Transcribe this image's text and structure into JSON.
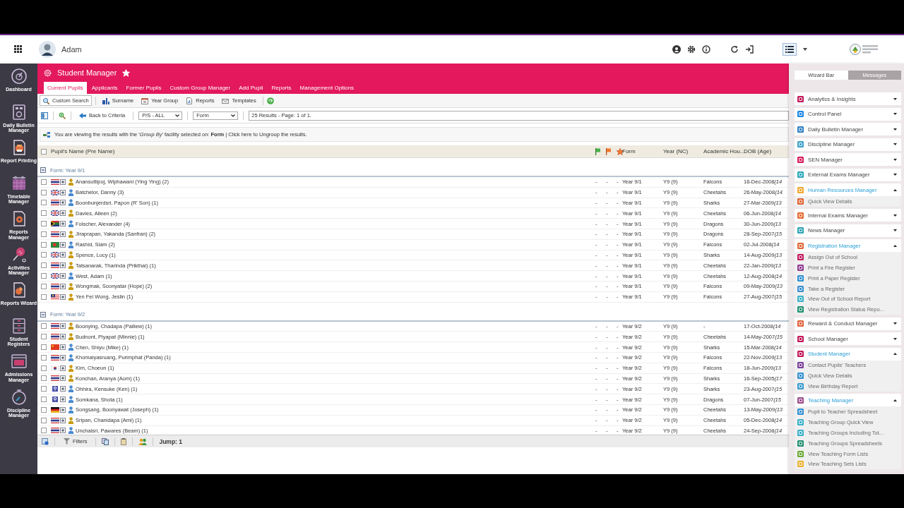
{
  "user": {
    "name": "Adam"
  },
  "sidebar": {
    "items": [
      {
        "label": "Dashboard"
      },
      {
        "label": "Daily Bulletin Manager"
      },
      {
        "label": "Report Printing"
      },
      {
        "label": "Timetable Manager"
      },
      {
        "label": "Reports Manager"
      },
      {
        "label": "Activities Manager"
      },
      {
        "label": "Reports Wizard"
      },
      {
        "label": "Student Registers"
      },
      {
        "label": "Admissions Manager"
      },
      {
        "label": "Discipline Manager"
      }
    ]
  },
  "module": {
    "title": "Student Manager",
    "favorite": true,
    "tabs": [
      {
        "label": "Current Pupils",
        "selected": true
      },
      {
        "label": "Applicants",
        "selected": false
      },
      {
        "label": "Former Pupils",
        "selected": false
      },
      {
        "label": "Custom Group Manager",
        "selected": false
      },
      {
        "label": "Add Pupil",
        "selected": false
      },
      {
        "label": "Reports",
        "selected": false
      },
      {
        "label": "Management Options",
        "selected": false
      }
    ]
  },
  "toolbar": {
    "buttons": [
      {
        "label": "Custom Search",
        "selected": true
      },
      {
        "label": "Surname",
        "selected": false
      },
      {
        "label": "Year Group",
        "selected": false
      },
      {
        "label": "Reports",
        "selected": false
      },
      {
        "label": "Templates",
        "selected": false
      }
    ]
  },
  "filter_bar": {
    "back": "Back to Criteria",
    "selects": [
      {
        "value": "P/S - ALL"
      },
      {
        "value": "Form"
      }
    ],
    "results": "25 Results - Page: 1 of 1."
  },
  "notice": "You are viewing the results with the '*Group By*' facility selected on: **Form** | Click here to Ungroup the results.",
  "table": {
    "select_all": {
      "checked": false
    },
    "columns": [
      "Pupil's Name (Pre Name)",
      "Form",
      "Year (NC)",
      "Academic Hou...",
      "DOB (Age)"
    ],
    "groups": [
      {
        "label": "Form: Year 9/1",
        "expanded": true,
        "rows": [
          {
            "name": "Anansuttipoj, Wiphawani (Ying Ying) (2)",
            "checked": false,
            "flag": {
              "kind": "th"
            },
            "person": {
              "kind": "female"
            },
            "marks": [
              "-",
              "-",
              "-"
            ],
            "form": "Year 9/1",
            "year": "Y9 (9)",
            "house": "Falcons",
            "dob": "16-Dec-2008",
            "age": "(14"
          },
          {
            "name": "Batchelor, Danny (3)",
            "checked": false,
            "flag": {
              "kind": "uk"
            },
            "person": {
              "kind": "male"
            },
            "marks": [
              "-",
              "-",
              "-"
            ],
            "form": "Year 9/1",
            "year": "Y9 (9)",
            "house": "Cheetahs",
            "dob": "26-May-2008",
            "age": "(14"
          },
          {
            "name": "Boonbunjerdsri, Papon (R' Son) (1)",
            "checked": false,
            "flag": {
              "kind": "th"
            },
            "person": {
              "kind": "male"
            },
            "marks": [
              "-",
              "-",
              "-"
            ],
            "form": "Year 9/1",
            "year": "Y9 (9)",
            "house": "Sharks",
            "dob": "27-Mar-2009",
            "age": "(13"
          },
          {
            "name": "Davies, Aileen (2)",
            "checked": false,
            "flag": {
              "kind": "uk"
            },
            "person": {
              "kind": "female"
            },
            "marks": [
              "-",
              "-",
              "-"
            ],
            "form": "Year 9/1",
            "year": "Y9 (9)",
            "house": "Cheetahs",
            "dob": "06-Jun-2008",
            "age": "(14"
          },
          {
            "name": "Folscher, Alexander (4)",
            "checked": false,
            "flag": {
              "kind": "za"
            },
            "person": {
              "kind": "male"
            },
            "marks": [
              "-",
              "-",
              "-"
            ],
            "form": "Year 9/1",
            "year": "Y9 (9)",
            "house": "Dragons",
            "dob": "30-Jun-2009",
            "age": "(13"
          },
          {
            "name": "Jiraprapan, Yakanda (Sanfran) (2)",
            "checked": false,
            "flag": {
              "kind": "th"
            },
            "person": {
              "kind": "female"
            },
            "marks": [
              "-",
              "-",
              "-"
            ],
            "form": "Year 9/1",
            "year": "Y9 (9)",
            "house": "Dragons",
            "dob": "28-Sep-2007",
            "age": "(15"
          },
          {
            "name": "Rashid, Siam (2)",
            "checked": false,
            "flag": {
              "kind": "bd"
            },
            "person": {
              "kind": "male"
            },
            "marks": [
              "-",
              "-",
              "-"
            ],
            "form": "Year 9/1",
            "year": "Y9 (9)",
            "house": "Falcons",
            "dob": "02-Jul-2008",
            "age": "(14"
          },
          {
            "name": "Spence, Lucy (1)",
            "checked": false,
            "flag": {
              "kind": "uk"
            },
            "person": {
              "kind": "female"
            },
            "marks": [
              "-",
              "-",
              "-"
            ],
            "form": "Year 9/1",
            "year": "Y9 (9)",
            "house": "Sharks",
            "dob": "14-Aug-2009",
            "age": "(13"
          },
          {
            "name": "Tatsanarak, Tharinda (Prikthai) (1)",
            "checked": false,
            "flag": {
              "kind": "th"
            },
            "person": {
              "kind": "female"
            },
            "marks": [
              "-",
              "-",
              "-"
            ],
            "form": "Year 9/1",
            "year": "Y9 (9)",
            "house": "Cheetahs",
            "dob": "22-Jan-2009",
            "age": "(13"
          },
          {
            "name": "West, Adam (1)",
            "checked": false,
            "flag": {
              "kind": "uk"
            },
            "person": {
              "kind": "male"
            },
            "marks": [
              "-",
              "-",
              "-"
            ],
            "form": "Year 9/1",
            "year": "Y9 (9)",
            "house": "Cheetahs",
            "dob": "12-Aug-2008",
            "age": "(14"
          },
          {
            "name": "Wongmak, Soonyatar (Hope) (2)",
            "checked": false,
            "flag": {
              "kind": "th"
            },
            "person": {
              "kind": "female"
            },
            "marks": [
              "-",
              "-",
              "-"
            ],
            "form": "Year 9/1",
            "year": "Y9 (9)",
            "house": "Falcons",
            "dob": "09-May-2009",
            "age": "(13"
          },
          {
            "name": "Yen Fei Wong, Jeslin (1)",
            "checked": false,
            "flag": {
              "kind": "my"
            },
            "person": {
              "kind": "female"
            },
            "marks": [
              "-",
              "-",
              "-"
            ],
            "form": "Year 9/1",
            "year": "Y9 (9)",
            "house": "Falcons",
            "dob": "27-Aug-2007",
            "age": "(15"
          }
        ]
      },
      {
        "label": "Form: Year 9/2",
        "expanded": true,
        "rows": [
          {
            "name": "Boonying, Chadapa (Pailiew) (1)",
            "checked": false,
            "flag": {
              "kind": "th"
            },
            "person": {
              "kind": "female"
            },
            "marks": [
              "-",
              "-",
              "-"
            ],
            "form": "Year 9/2",
            "year": "Y9 (9)",
            "house": "-",
            "dob": "17-Oct-2008",
            "age": "(14"
          },
          {
            "name": "Budnont, Piyapat (Minnie) (1)",
            "checked": false,
            "flag": {
              "kind": "th"
            },
            "person": {
              "kind": "female"
            },
            "marks": [
              "-",
              "-",
              "-"
            ],
            "form": "Year 9/2",
            "year": "Y9 (9)",
            "house": "Cheetahs",
            "dob": "14-May-2007",
            "age": "(15"
          },
          {
            "name": "Chen, Shiyu (Mike) (1)",
            "checked": false,
            "flag": {
              "kind": "cn"
            },
            "person": {
              "kind": "male"
            },
            "marks": [
              "-",
              "-",
              "-"
            ],
            "form": "Year 9/2",
            "year": "Y9 (9)",
            "house": "Sharks",
            "dob": "15-Mar-2008",
            "age": "(14"
          },
          {
            "name": "Khomaiyasruang, Purimphat (Panda) (1)",
            "checked": false,
            "flag": {
              "kind": "th"
            },
            "person": {
              "kind": "male"
            },
            "marks": [
              "-",
              "-",
              "-"
            ],
            "form": "Year 9/2",
            "year": "Y9 (9)",
            "house": "Falcons",
            "dob": "22-Nov-2009",
            "age": "(13"
          },
          {
            "name": "Kim, Choeun (1)",
            "checked": false,
            "flag": {
              "kind": "kr"
            },
            "person": {
              "kind": "female"
            },
            "marks": [
              "-",
              "-",
              "-"
            ],
            "form": "Year 9/2",
            "year": "Y9 (9)",
            "house": "Falcons",
            "dob": "18-Jun-2009",
            "age": "(13"
          },
          {
            "name": "Konchan, Aranya (Aom) (1)",
            "checked": false,
            "flag": {
              "kind": "th"
            },
            "person": {
              "kind": "female"
            },
            "marks": [
              "-",
              "-",
              "-"
            ],
            "form": "Year 9/2",
            "year": "Y9 (9)",
            "house": "Sharks",
            "dob": "16-Sep-2005",
            "age": "(17"
          },
          {
            "name": "Ohhira, Kensuke (Ken) (1)",
            "checked": false,
            "flag": {
              "kind": "unknown"
            },
            "person": {
              "kind": "male"
            },
            "marks": [
              "-",
              "-",
              "-"
            ],
            "form": "Year 9/2",
            "year": "Y9 (9)",
            "house": "Sharks",
            "dob": "23-Aug-2007",
            "age": "(15"
          },
          {
            "name": "Somkana, Shota (1)",
            "checked": false,
            "flag": {
              "kind": "unknown"
            },
            "person": {
              "kind": "male"
            },
            "marks": [
              "-",
              "-",
              "-"
            ],
            "form": "Year 9/2",
            "year": "Y9 (9)",
            "house": "Dragons",
            "dob": "07-Jun-2007",
            "age": "(15"
          },
          {
            "name": "Songsang, Boonyawat (Joseph) (1)",
            "checked": false,
            "flag": {
              "kind": "de"
            },
            "person": {
              "kind": "male"
            },
            "marks": [
              "-",
              "-",
              "-"
            ],
            "form": "Year 9/2",
            "year": "Y9 (9)",
            "house": "Cheetahs",
            "dob": "13-May-2009",
            "age": "(13"
          },
          {
            "name": "Sripan, Chanidapa (Ami) (1)",
            "checked": false,
            "flag": {
              "kind": "th"
            },
            "person": {
              "kind": "female"
            },
            "marks": [
              "-",
              "-",
              "-"
            ],
            "form": "Year 9/2",
            "year": "Y9 (9)",
            "house": "Cheetahs",
            "dob": "05-Dec-2008",
            "age": "(14"
          },
          {
            "name": "Unchaisri, Pawares (Beam) (1)",
            "checked": false,
            "flag": {
              "kind": "th"
            },
            "person": {
              "kind": "male"
            },
            "marks": [
              "-",
              "-",
              "-"
            ],
            "form": "Year 9/2",
            "year": "Y9 (9)",
            "house": "Cheetahs",
            "dob": "24-Sep-2008",
            "age": "(14"
          }
        ]
      }
    ]
  },
  "status_bar": {
    "filters": "Filters",
    "jump": "Jump: 1"
  },
  "wizard": {
    "tabs": [
      {
        "label": "Wizard Bar",
        "selected": true
      },
      {
        "label": "Messages",
        "selected": false
      }
    ],
    "modules": [
      {
        "label": "Analytics & Insights",
        "color": "#c2185b",
        "expanded": false
      },
      {
        "label": "Control Panel",
        "color": "#1e88e5",
        "expanded": false
      },
      {
        "label": "Daily Bulletin Manager",
        "color": "#2f7fc1",
        "expanded": false
      },
      {
        "label": "Discipline Manager",
        "color": "#3aa0c8",
        "expanded": false
      },
      {
        "label": "SEN Manager",
        "color": "#d81b60",
        "expanded": false
      },
      {
        "label": "External Exams Manager",
        "color": "#26a6b8",
        "expanded": false
      },
      {
        "label": "Human Resources Manager",
        "color": "#f0a830",
        "expanded": true,
        "children": [
          {
            "label": "Quick View Details",
            "color": "#e06030"
          }
        ]
      },
      {
        "label": "Internal Exams Manager",
        "color": "#e8662e",
        "expanded": false
      },
      {
        "label": "News Manager",
        "color": "#2aa3b5",
        "expanded": false
      },
      {
        "label": "Registration Manager",
        "color": "#e06a3a",
        "expanded": true,
        "children": [
          {
            "label": "Assign Out of School",
            "color": "#c2185b"
          },
          {
            "label": "Print a Fire Register",
            "color": "#8e3a8e"
          },
          {
            "label": "Print a Paper Register",
            "color": "#2f8fd0"
          },
          {
            "label": "Take a Register",
            "color": "#3a8fd0"
          },
          {
            "label": "View Out of School Report",
            "color": "#3ab0c8"
          },
          {
            "label": "View Registration Status Repo...",
            "color": "#1f8f6f"
          }
        ]
      },
      {
        "label": "Reward & Conduct Manager",
        "color": "#e0603a",
        "expanded": false
      },
      {
        "label": "School Manager",
        "color": "#c2185b",
        "expanded": false
      },
      {
        "label": "Student Manager",
        "color": "#c2185b",
        "expanded": true,
        "children": [
          {
            "label": "Contact Pupils' Teachers",
            "color": "#7b3f9a"
          },
          {
            "label": "Quick View Details",
            "color": "#2f8fd0"
          },
          {
            "label": "View Birthday Report",
            "color": "#3a9ad0"
          }
        ]
      },
      {
        "label": "Teaching Manager",
        "color": "#9a4a8a",
        "expanded": true,
        "children": [
          {
            "label": "Pupil to Teacher Spreadsheet",
            "color": "#2f8fd0"
          },
          {
            "label": "Teaching Group Quick View",
            "color": "#3ab0c8"
          },
          {
            "label": "Teaching Groups Including Tot...",
            "color": "#3ab0c8"
          },
          {
            "label": "Teaching Groups Spreadsheets",
            "color": "#1f8f6f"
          },
          {
            "label": "View Teaching Form Lists",
            "color": "#6aaa3a"
          },
          {
            "label": "View Teaching Sets Lists",
            "color": "#f0b030"
          }
        ]
      }
    ]
  }
}
